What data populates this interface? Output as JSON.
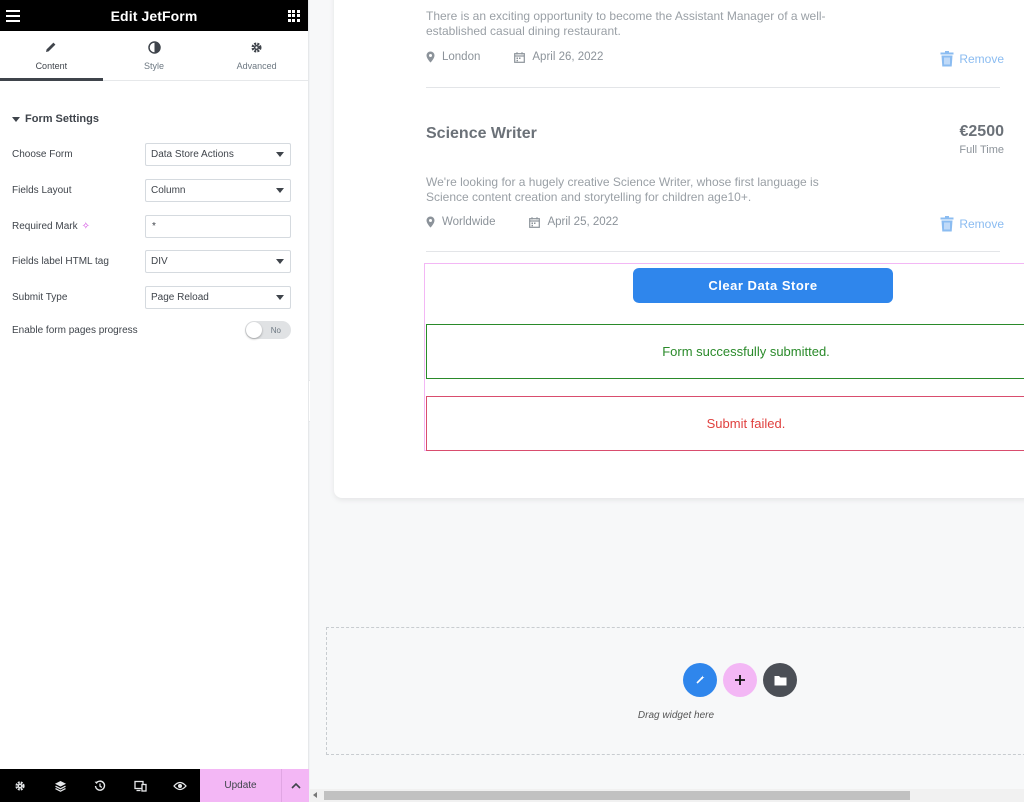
{
  "panel": {
    "title": "Edit JetForm",
    "tabs": [
      {
        "label": "Content",
        "icon": "pencil-icon",
        "active": true
      },
      {
        "label": "Style",
        "icon": "contrast-icon",
        "active": false
      },
      {
        "label": "Advanced",
        "icon": "gear-icon",
        "active": false
      }
    ],
    "section_title": "Form Settings",
    "fields": {
      "choose_form": {
        "label": "Choose Form",
        "value": "Data Store Actions"
      },
      "fields_layout": {
        "label": "Fields Layout",
        "value": "Column"
      },
      "required_mark": {
        "label": "Required Mark",
        "value": "*"
      },
      "label_tag": {
        "label": "Fields label HTML tag",
        "value": "DIV"
      },
      "submit_type": {
        "label": "Submit Type",
        "value": "Page Reload"
      },
      "pages_progress": {
        "label": "Enable form pages progress",
        "toggle": "No"
      }
    },
    "footer": {
      "update_label": "Update"
    }
  },
  "preview": {
    "job1": {
      "description": "There is an exciting opportunity to become the Assistant Manager of a well-established casual dining restaurant.",
      "location": "London",
      "date": "April 26, 2022",
      "remove_label": "Remove"
    },
    "job2": {
      "title": "Science Writer",
      "salary": "€2500",
      "type": "Full Time",
      "description": "We're looking for a hugely creative Science Writer, whose first language is Science content creation and storytelling for children age10+.",
      "location": "Worldwide",
      "date": "April 25, 2022",
      "remove_label": "Remove"
    },
    "clear_button": "Clear Data Store",
    "success_message": "Form successfully submitted.",
    "fail_message": "Submit failed.",
    "drop_label": "Drag widget here"
  },
  "colors": {
    "accent_blue": "#2f86ec",
    "accent_pink": "#f3b7f5",
    "success": "#2a8a2a",
    "error": "#e0413f"
  }
}
